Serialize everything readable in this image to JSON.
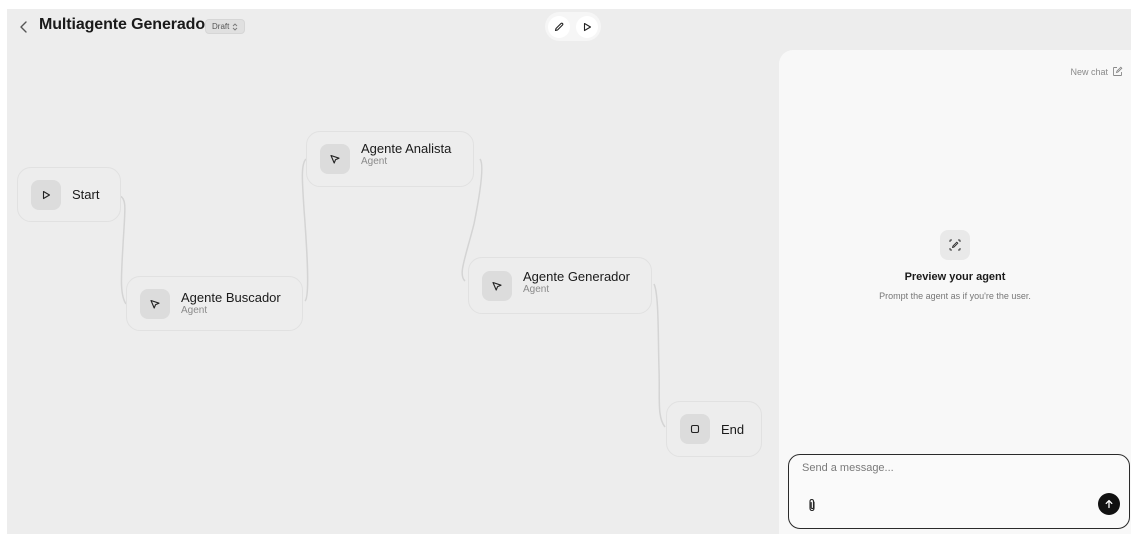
{
  "header": {
    "back_icon": "chevron-left-icon",
    "title": "Multiagente Generador",
    "status_badge": "Draft",
    "status_badge_icon": "chevron-updown-icon",
    "tools": [
      {
        "name": "edit",
        "icon": "pencil-icon"
      },
      {
        "name": "run",
        "icon": "play-icon"
      }
    ]
  },
  "workflow": {
    "nodes": [
      {
        "id": "start",
        "label": "Start",
        "sublabel": "",
        "icon": "play-icon"
      },
      {
        "id": "buscador",
        "label": "Agente Buscador",
        "sublabel": "Agent",
        "icon": "cursor-icon"
      },
      {
        "id": "analista",
        "label": "Agente Analista",
        "sublabel": "Agent",
        "icon": "cursor-icon"
      },
      {
        "id": "generador",
        "label": "Agente Generador",
        "sublabel": "Agent",
        "icon": "cursor-icon"
      },
      {
        "id": "end",
        "label": "End",
        "sublabel": "",
        "icon": "stop-icon"
      }
    ],
    "edges": [
      [
        "start",
        "buscador"
      ],
      [
        "buscador",
        "analista"
      ],
      [
        "analista",
        "generador"
      ],
      [
        "generador",
        "end"
      ]
    ]
  },
  "preview": {
    "new_chat_label": "New chat",
    "new_chat_icon": "edit-icon",
    "icon": "sparkle-edit-icon",
    "title": "Preview your agent",
    "subtitle": "Prompt the agent as if you're the user."
  },
  "composer": {
    "placeholder": "Send a message...",
    "value": "",
    "attach_icon": "paperclip-icon",
    "send_icon": "arrow-up-icon"
  },
  "colors": {
    "canvas_bg": "#ededed",
    "panel_bg": "#f8f8f8",
    "send_button": "#111111"
  }
}
